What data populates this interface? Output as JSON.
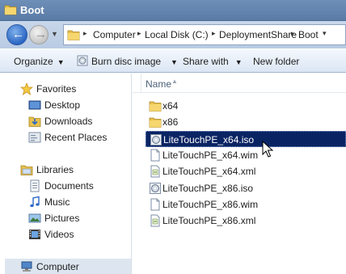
{
  "window": {
    "title": "Boot"
  },
  "address": {
    "crumbs": [
      "Computer",
      "Local Disk (C:)",
      "DeploymentShare",
      "Boot"
    ]
  },
  "toolbar": {
    "organize": "Organize",
    "burn": "Burn disc image",
    "share": "Share with",
    "new_folder": "New folder"
  },
  "nav": {
    "favorites": "Favorites",
    "desktop": "Desktop",
    "downloads": "Downloads",
    "recent": "Recent Places",
    "libraries": "Libraries",
    "documents": "Documents",
    "music": "Music",
    "pictures": "Pictures",
    "videos": "Videos",
    "computer": "Computer"
  },
  "columns": {
    "name": "Name"
  },
  "files": [
    {
      "name": "x64",
      "icon": "folder-icon"
    },
    {
      "name": "x86",
      "icon": "folder-icon"
    },
    {
      "name": "LiteTouchPE_x64.iso",
      "icon": "disc-image-icon",
      "selected": true
    },
    {
      "name": "LiteTouchPE_x64.wim",
      "icon": "file-icon"
    },
    {
      "name": "LiteTouchPE_x64.xml",
      "icon": "xml-file-icon"
    },
    {
      "name": "LiteTouchPE_x86.iso",
      "icon": "disc-image-icon"
    },
    {
      "name": "LiteTouchPE_x86.wim",
      "icon": "file-icon"
    },
    {
      "name": "LiteTouchPE_x86.xml",
      "icon": "xml-file-icon"
    }
  ]
}
